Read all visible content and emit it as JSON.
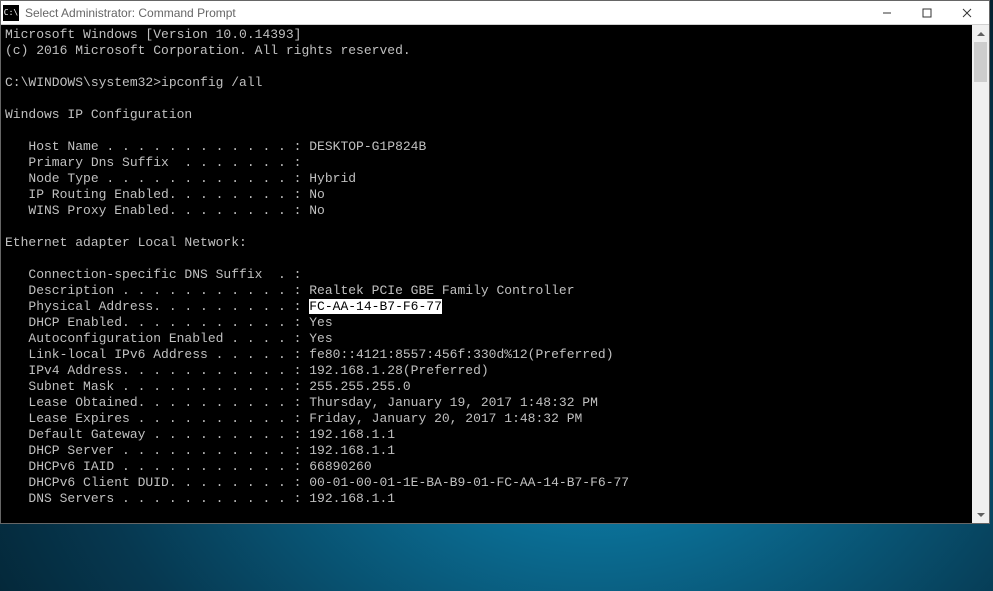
{
  "titlebar": {
    "icon_label": "C:\\",
    "title": "Select Administrator: Command Prompt"
  },
  "terminal": {
    "header1": "Microsoft Windows [Version 10.0.14393]",
    "header2": "(c) 2016 Microsoft Corporation. All rights reserved.",
    "prompt": "C:\\WINDOWS\\system32>",
    "command": "ipconfig /all",
    "section_ipconfig": "Windows IP Configuration",
    "host_name_label": "   Host Name . . . . . . . . . . . . : ",
    "host_name_value": "DESKTOP-G1P824B",
    "primary_dns_label": "   Primary Dns Suffix  . . . . . . . :",
    "node_type_label": "   Node Type . . . . . . . . . . . . : ",
    "node_type_value": "Hybrid",
    "ip_routing_label": "   IP Routing Enabled. . . . . . . . : ",
    "ip_routing_value": "No",
    "wins_proxy_label": "   WINS Proxy Enabled. . . . . . . . : ",
    "wins_proxy_value": "No",
    "section_adapter": "Ethernet adapter Local Network:",
    "conn_suffix_label": "   Connection-specific DNS Suffix  . :",
    "description_label": "   Description . . . . . . . . . . . : ",
    "description_value": "Realtek PCIe GBE Family Controller",
    "physical_label": "   Physical Address. . . . . . . . . : ",
    "physical_value": "FC-AA-14-B7-F6-77",
    "dhcp_enabled_label": "   DHCP Enabled. . . . . . . . . . . : ",
    "dhcp_enabled_value": "Yes",
    "autoconfig_label": "   Autoconfiguration Enabled . . . . : ",
    "autoconfig_value": "Yes",
    "link_local_label": "   Link-local IPv6 Address . . . . . : ",
    "link_local_value": "fe80::4121:8557:456f:330d%12(Preferred)",
    "ipv4_label": "   IPv4 Address. . . . . . . . . . . : ",
    "ipv4_value": "192.168.1.28(Preferred)",
    "subnet_label": "   Subnet Mask . . . . . . . . . . . : ",
    "subnet_value": "255.255.255.0",
    "lease_obtained_label": "   Lease Obtained. . . . . . . . . . : ",
    "lease_obtained_value": "Thursday, January 19, 2017 1:48:32 PM",
    "lease_expires_label": "   Lease Expires . . . . . . . . . . : ",
    "lease_expires_value": "Friday, January 20, 2017 1:48:32 PM",
    "default_gw_label": "   Default Gateway . . . . . . . . . : ",
    "default_gw_value": "192.168.1.1",
    "dhcp_server_label": "   DHCP Server . . . . . . . . . . . : ",
    "dhcp_server_value": "192.168.1.1",
    "dhcpv6_iaid_label": "   DHCPv6 IAID . . . . . . . . . . . : ",
    "dhcpv6_iaid_value": "66890260",
    "dhcpv6_duid_label": "   DHCPv6 Client DUID. . . . . . . . : ",
    "dhcpv6_duid_value": "00-01-00-01-1E-BA-B9-01-FC-AA-14-B7-F6-77",
    "dns_servers_label": "   DNS Servers . . . . . . . . . . . : ",
    "dns_servers_value": "192.168.1.1"
  }
}
